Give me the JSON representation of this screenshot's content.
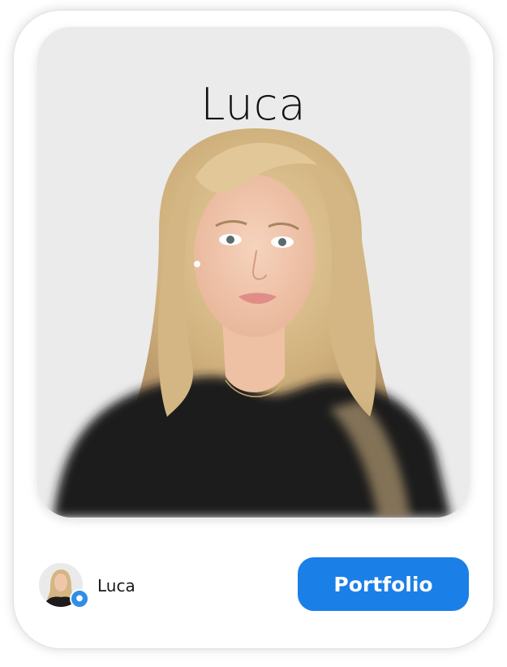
{
  "profile": {
    "name": "Luca",
    "avatar_name": "Luca",
    "portfolio_label": "Portfolio",
    "badge_icon": "chat-bubble-icon"
  },
  "colors": {
    "accent": "#1b7fe8",
    "card_bg": "#ffffff",
    "photo_bg": "#ebebeb",
    "hair": "#d8c08f",
    "top": "#1c181a",
    "skin": "#f0c6ab"
  }
}
